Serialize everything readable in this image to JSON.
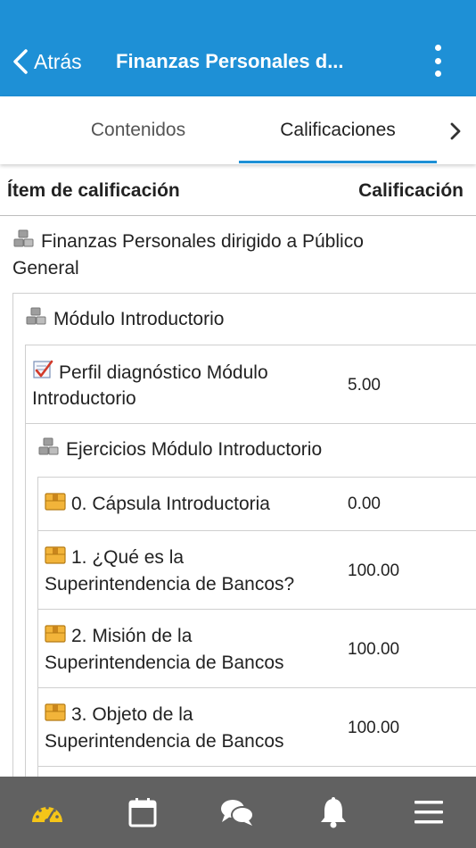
{
  "header": {
    "back_label": "Atrás",
    "title": "Finanzas Personales d..."
  },
  "tabs": [
    {
      "label": "Contenidos"
    },
    {
      "label": "Calificaciones"
    }
  ],
  "table": {
    "col_item": "Ítem de calificación",
    "col_grade": "Calificación"
  },
  "rows": [
    {
      "name": "Finanzas Personales dirigido a Público General",
      "line1": "Finanzas Personales dirigido a Público",
      "line2": "General",
      "grade": "",
      "icon": "category-icon"
    },
    {
      "name": "Módulo Introductorio",
      "grade": "",
      "icon": "category-icon"
    },
    {
      "name": "Perfil diagnóstico Módulo Introductorio",
      "line1": "Perfil diagnóstico Módulo",
      "line2": "Introductorio",
      "grade": "5.00",
      "icon": "quiz-icon"
    },
    {
      "name": "Ejercicios Módulo Introductorio",
      "grade": "",
      "icon": "category-icon"
    },
    {
      "name": "0. Cápsula Introductoria",
      "grade": "0.00",
      "icon": "scorm-package-icon"
    },
    {
      "name": "1. ¿Qué es la Superintendencia de Bancos?",
      "line1": "1. ¿Qué es la",
      "line2": "Superintendencia de Bancos?",
      "grade": "100.00",
      "icon": "scorm-package-icon"
    },
    {
      "name": "2. Misión de la Superintendencia de Bancos",
      "line1": "2. Misión de la",
      "line2": "Superintendencia de Bancos",
      "grade": "100.00",
      "icon": "scorm-package-icon"
    },
    {
      "name": "3. Objeto de la Superintendencia de Bancos",
      "line1": "3. Objeto de la",
      "line2": "Superintendencia de Bancos",
      "grade": "100.00",
      "icon": "scorm-package-icon"
    }
  ],
  "bottom_nav": [
    {
      "icon": "dashboard-icon",
      "active": true
    },
    {
      "icon": "calendar-icon",
      "active": false
    },
    {
      "icon": "messages-icon",
      "active": false
    },
    {
      "icon": "notifications-icon",
      "active": false
    },
    {
      "icon": "menu-icon",
      "active": false
    }
  ],
  "colors": {
    "header": "#1e90d6",
    "bottom_bar": "#616161",
    "active_nav": "#f5c518"
  }
}
